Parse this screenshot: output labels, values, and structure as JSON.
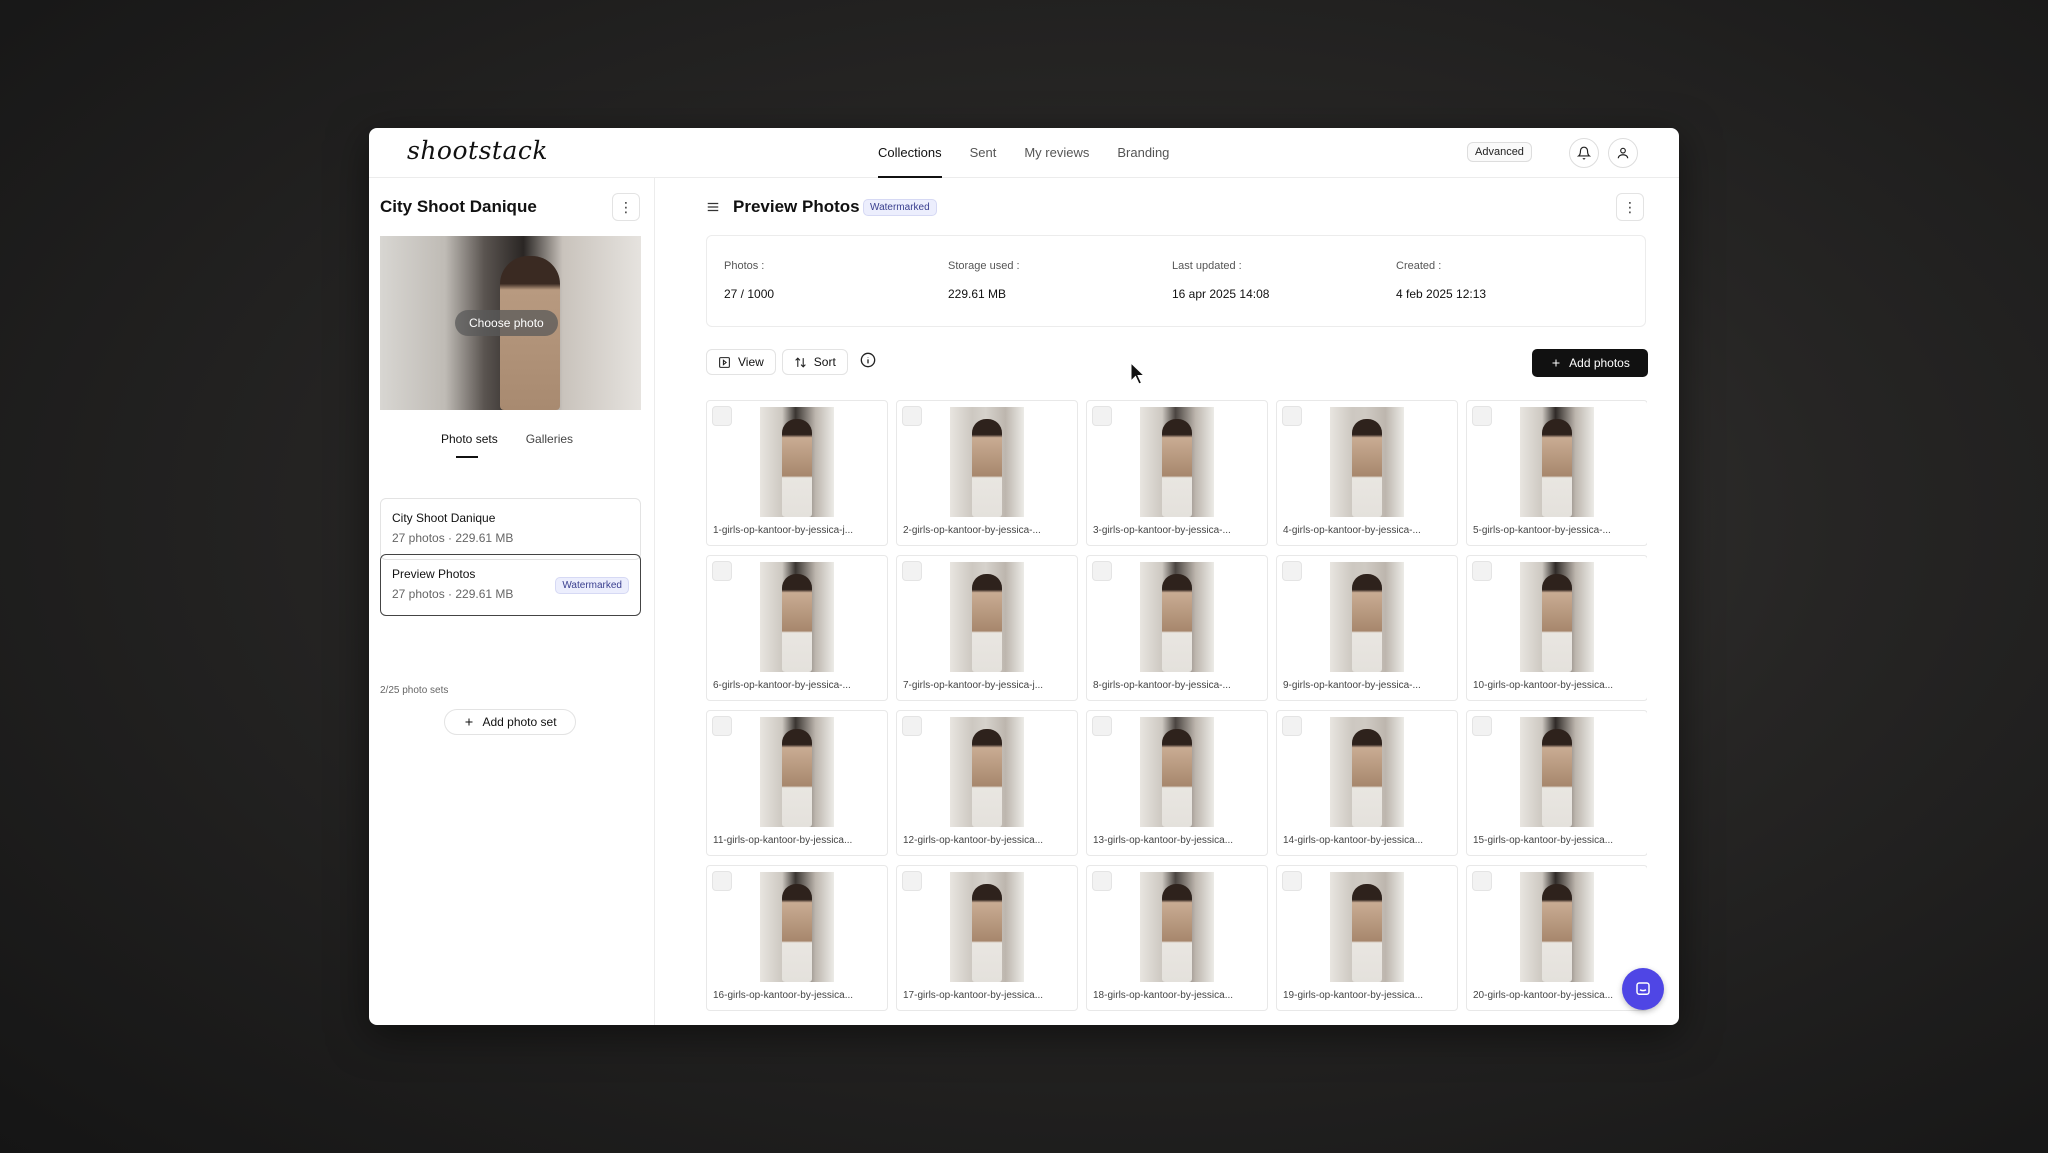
{
  "app": {
    "logo_text": "shootstack",
    "nav": [
      "Collections",
      "Sent",
      "My reviews",
      "Branding"
    ],
    "plan_badge": "Advanced"
  },
  "sidebar": {
    "collection_title": "City Shoot Danique",
    "choose_photo": "Choose photo",
    "tabs": [
      "Photo sets",
      "Galleries"
    ],
    "sets": [
      {
        "name": "City Shoot Danique",
        "meta": "27 photos · 229.61 MB",
        "badge": ""
      },
      {
        "name": "Preview Photos",
        "meta": "27 photos · 229.61 MB",
        "badge": "Watermarked"
      }
    ],
    "sets_count": "2/25 photo sets",
    "add_set_label": "Add photo set"
  },
  "main": {
    "title": "Preview Photos",
    "badge": "Watermarked",
    "stats": [
      {
        "label": "Photos :",
        "value": "27 / 1000"
      },
      {
        "label": "Storage used :",
        "value": "229.61 MB"
      },
      {
        "label": "Last updated :",
        "value": "16 apr 2025 14:08"
      },
      {
        "label": "Created :",
        "value": "4 feb 2025 12:13"
      }
    ],
    "view_label": "View",
    "sort_label": "Sort",
    "add_photos_label": "Add photos",
    "photos": [
      "1-girls-op-kantoor-by-jessica-j...",
      "2-girls-op-kantoor-by-jessica-...",
      "3-girls-op-kantoor-by-jessica-...",
      "4-girls-op-kantoor-by-jessica-...",
      "5-girls-op-kantoor-by-jessica-...",
      "6-girls-op-kantoor-by-jessica-...",
      "7-girls-op-kantoor-by-jessica-j...",
      "8-girls-op-kantoor-by-jessica-...",
      "9-girls-op-kantoor-by-jessica-...",
      "10-girls-op-kantoor-by-jessica...",
      "11-girls-op-kantoor-by-jessica...",
      "12-girls-op-kantoor-by-jessica...",
      "13-girls-op-kantoor-by-jessica...",
      "14-girls-op-kantoor-by-jessica...",
      "15-girls-op-kantoor-by-jessica...",
      "16-girls-op-kantoor-by-jessica...",
      "17-girls-op-kantoor-by-jessica...",
      "18-girls-op-kantoor-by-jessica...",
      "19-girls-op-kantoor-by-jessica...",
      "20-girls-op-kantoor-by-jessica..."
    ]
  },
  "icons": {
    "bell": "bell-icon",
    "user": "user-icon",
    "kebab": "more-vertical-icon",
    "menu": "menu-icon",
    "view": "view-icon",
    "sort": "sort-icon",
    "info": "info-icon",
    "plus": "plus-icon",
    "chat": "chat-icon"
  },
  "colors": {
    "accent": "#111111",
    "badge_bg": "#eceefd",
    "badge_text": "#3a3f8f",
    "chat": "#4f46e5"
  }
}
